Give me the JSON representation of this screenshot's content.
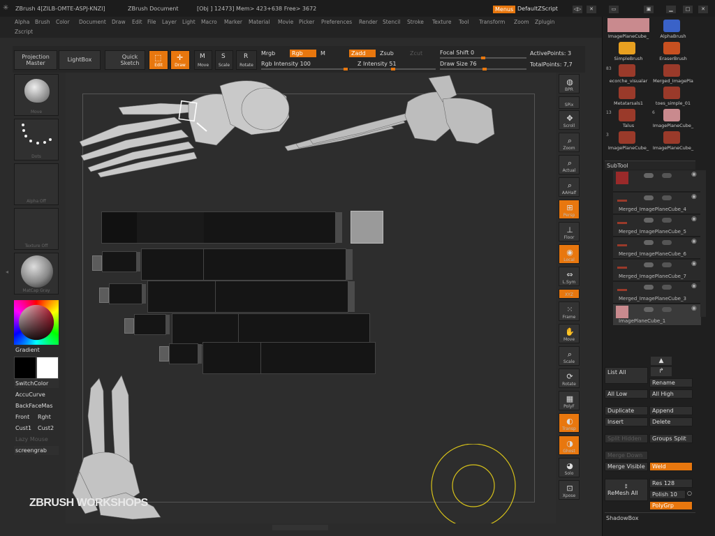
{
  "titlebar": {
    "app": "ZBrush 4[ZILB-OMTE-ASPJ-KNZI]",
    "doc": "ZBrush Document",
    "stats": "[Obj ] 12473] Mem> 423+638 Free> 3672",
    "menus_button": "Menus",
    "script_label": "DefaultZScript"
  },
  "menubar": {
    "items": [
      "Alpha",
      "Brush",
      "Color",
      "Document",
      "Draw",
      "Edit",
      "File",
      "Layer",
      "Light",
      "Macro",
      "Marker",
      "Material",
      "Movie",
      "Picker",
      "Preferences",
      "Render",
      "Stencil",
      "Stroke",
      "Texture",
      "Tool",
      "Transform",
      "Zoom",
      "Zplugin"
    ],
    "second_row": "Zscript"
  },
  "topshelf": {
    "projection_master": "Projection Master",
    "lightbox": "LightBox",
    "quick_sketch": "Quick Sketch",
    "edit": "Edit",
    "draw": "Draw",
    "move": "Move",
    "scale": "Scale",
    "rotate": "Rotate",
    "mrgb": "Mrgb",
    "rgb": "Rgb",
    "m": "M",
    "zadd": "Zadd",
    "zsub": "Zsub",
    "zcut": "Zcut",
    "rgb_intensity": "Rgb Intensity 100",
    "z_intensity": "Z Intensity 51",
    "focal_shift": "Focal Shift 0",
    "draw_size": "Draw Size 76",
    "active_points": "ActivePoints: 3",
    "total_points": "TotalPoints: 7,7",
    "rgb_intensity_value": 100,
    "z_intensity_value": 51,
    "focal_shift_value": 0,
    "draw_size_value": 76
  },
  "leftshelf": {
    "brush_cap": "Move",
    "stroke_cap": "Dots",
    "alpha_cap": "Alpha Off",
    "texture_cap": "Texture Off",
    "material_cap": "MatCap Gray",
    "gradient": "Gradient",
    "switchcolor": "SwitchColor",
    "accucurve": "AccuCurve",
    "backface": "BackFaceMas",
    "front": "Front",
    "right": "Rght",
    "cust1": "Cust1",
    "cust2": "Cust2",
    "lazy_mouse": "Lazy Mouse",
    "screengrab": "screengrab"
  },
  "rightshelf": {
    "items": [
      "BPR",
      "SPix",
      "Scroll",
      "Zoom",
      "Actual",
      "AAHalf",
      "Persp",
      "Floor",
      "Local",
      "L.Sym",
      "XYZ",
      "Frame",
      "Move",
      "Scale",
      "Rotate",
      "PolyF",
      "Transp",
      "Ghost",
      "Solo",
      "Xpose"
    ]
  },
  "tool_palette": {
    "tools": [
      {
        "name": "ImagePlaneCube_",
        "color": "#c98a8e"
      },
      {
        "name": "AlphaBrush",
        "color": "#3a62c8"
      },
      {
        "name": "SimpleBrush",
        "color": "#e8a020"
      },
      {
        "name": "EraserBrush",
        "color": "#c85020"
      },
      {
        "name": "ecorche_visualar",
        "color": "#9a3a2a"
      },
      {
        "name": "Merged_ImagePla",
        "color": "#9a3a2a"
      },
      {
        "name": "Metatarsals1",
        "color": "#9a3a2a"
      },
      {
        "name": "toes_simple_01",
        "color": "#9a3a2a"
      },
      {
        "name": "Talus",
        "color": "#9a3a2a"
      },
      {
        "name": "ImagePlaneCube_",
        "color": "#c98a8e"
      },
      {
        "name": "ImagePlaneCube_",
        "color": "#9a3a2a"
      },
      {
        "name": "ImagePlaneCube_",
        "color": "#9a3a2a"
      }
    ],
    "counts": [
      "83",
      "13",
      "6",
      "3"
    ]
  },
  "subtool": {
    "header": "SubTool",
    "items": [
      "",
      "Merged_ImagePlaneCube_4",
      "Merged_ImagePlaneCube_5",
      "Merged_ImagePlaneCube_6",
      "Merged_ImagePlaneCube_7",
      "Merged_ImagePlaneCube_3",
      "ImagePlaneCube_1"
    ],
    "list_all": "List All",
    "rename": "Rename",
    "all_low": "All Low",
    "all_high": "All High",
    "duplicate": "Duplicate",
    "append": "Append",
    "insert": "Insert",
    "delete": "Delete",
    "split_hidden": "Split Hidden",
    "groups_split": "Groups Split",
    "merge_down": "Merge Down",
    "merge_visible": "Merge Visible",
    "weld": "Weld",
    "remesh_all": "ReMesh All",
    "res": "Res 128",
    "polish": "Polish 10",
    "polygrp": "PolyGrp",
    "shadowbox": "ShadowBox"
  },
  "watermark": "ZBRUSH WORKSHOPS",
  "colors": {
    "accent": "#e8770e",
    "background": "#2b2b2b",
    "panel": "#1f1f1f"
  }
}
